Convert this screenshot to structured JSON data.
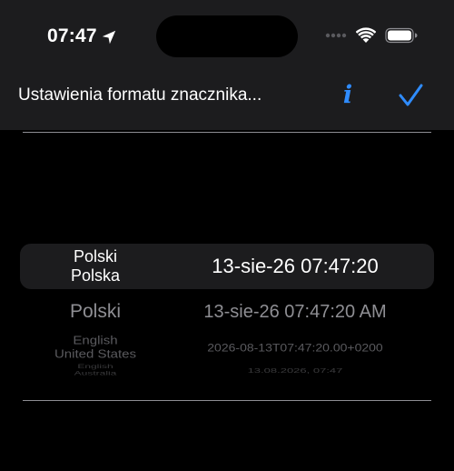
{
  "status_bar": {
    "time": "07:47",
    "icons": {
      "location": "location-arrow-icon",
      "signal": "cellular-signal-icon",
      "wifi": "wifi-icon",
      "battery": "battery-icon"
    }
  },
  "nav": {
    "title": "Ustawienia formatu znacznika...",
    "info_label": "i",
    "done_icon": "checkmark-icon"
  },
  "colors": {
    "accent": "#2f8cff",
    "background": "#000000",
    "bar_background": "#1c1c1e",
    "selection_background": "#1c1c1e",
    "divider": "#8e8e93"
  },
  "picker": {
    "rows": [
      {
        "language": "Polski",
        "region": "Polska",
        "format": "13-sie-26 07:47:20",
        "selected": true
      },
      {
        "language": "Polski",
        "region": "",
        "format": "13-sie-26 07:47:20 AM",
        "selected": false
      },
      {
        "language": "English",
        "region": "United States",
        "format": "2026-08-13T07:47:20.00+0200",
        "selected": false
      },
      {
        "language": "English",
        "region": "Australia",
        "format": "13.08.2026, 07:47",
        "selected": false
      }
    ]
  }
}
